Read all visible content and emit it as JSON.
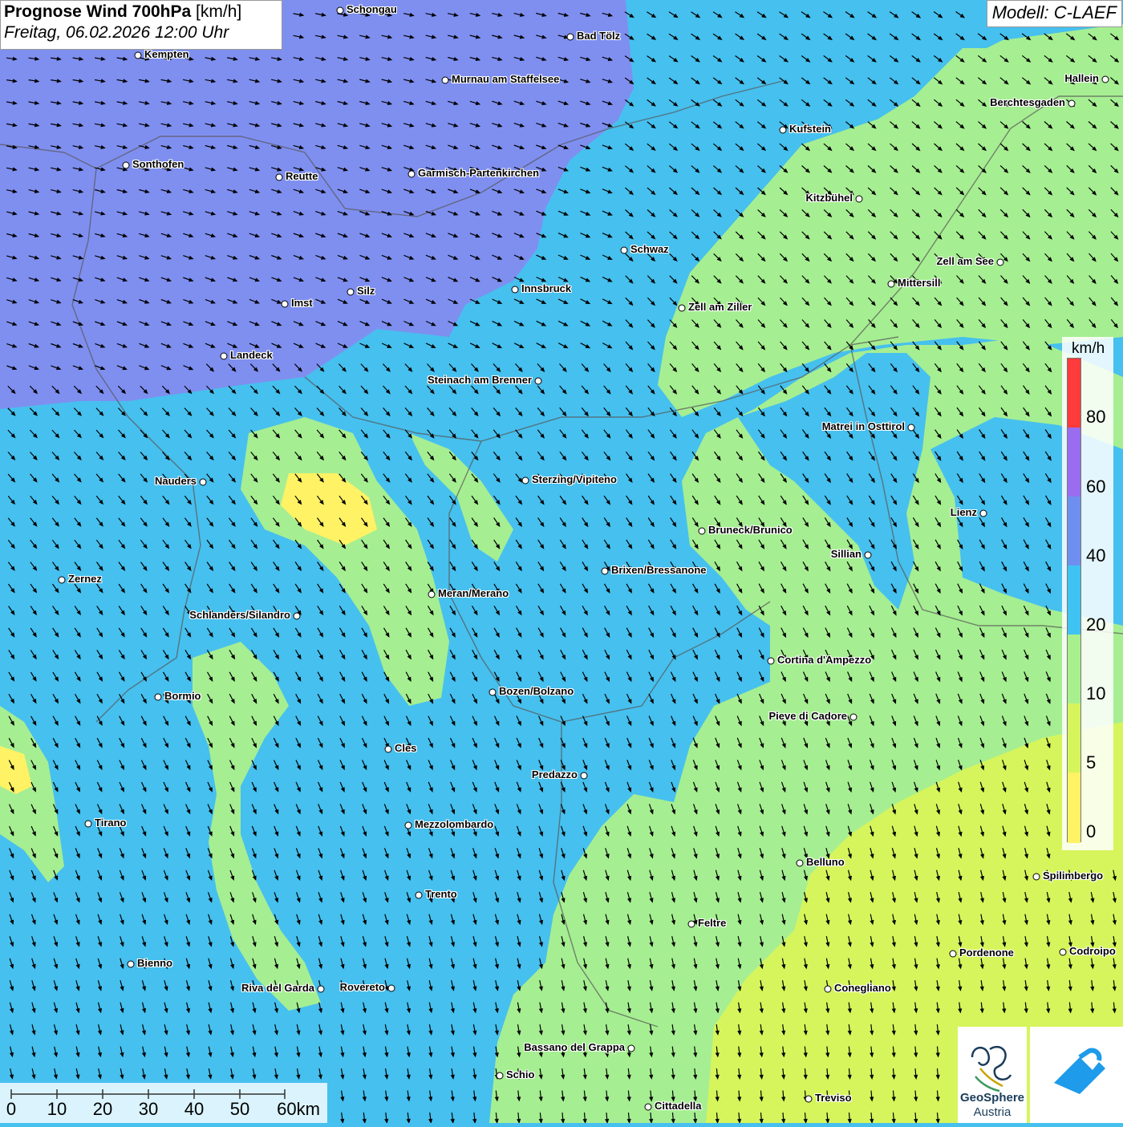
{
  "title": {
    "main": "Prognose Wind 700hPa",
    "unit": "[km/h]",
    "date": "Freitag, 06.02.2026 12:00 Uhr"
  },
  "model": "Modell: C-LAEF",
  "legend": {
    "unit": "km/h",
    "ticks": [
      "80",
      "60",
      "40",
      "20",
      "10",
      "5",
      "0"
    ],
    "colors": [
      "#ff3b3b",
      "#9a6cf0",
      "#6f8ff0",
      "#3ec3f2",
      "#a8f08e",
      "#d6f55c",
      "#fff264"
    ]
  },
  "scale_bar": {
    "labels": [
      "0",
      "10",
      "20",
      "30",
      "40",
      "50",
      "60km"
    ]
  },
  "logo": {
    "text_1": "GeoSphere",
    "text_2": "Austria"
  },
  "cities": [
    "Schongau",
    "Bad Tölz",
    "Kempten",
    "Murnau am Staffelsee",
    "Hallein",
    "Berchtesgaden",
    "Kufstein",
    "Sonthofen",
    "Reutte",
    "Garmisch-Partenkirchen",
    "Kitzbühel",
    "Schwaz",
    "Zell am See",
    "Mittersill",
    "Innsbruck",
    "Silz",
    "Imst",
    "Zell am Ziller",
    "Landeck",
    "Steinach am Brenner",
    "Matrei in Osttirol",
    "Nauders",
    "Sterzing/Vipiteno",
    "Lienz",
    "Bruneck/Brunico",
    "Sillian",
    "Brixen/Bressanone",
    "Zernez",
    "Meran/Merano",
    "Schlanders/Silandro",
    "Cortina d'Ampezzo",
    "Bormio",
    "Bozen/Bolzano",
    "Pieve di Cadore",
    "Cles",
    "Predazzo",
    "Tirano",
    "Mezzolombardo",
    "Belluno",
    "Spilimbergo",
    "Trento",
    "Feltre",
    "Bienno",
    "Pordenone",
    "Codroipo",
    "Riva del Garda",
    "Rovereto",
    "Conegliano",
    "Bassano del Grappa",
    "Schio",
    "Treviso",
    "Cittadella"
  ]
}
